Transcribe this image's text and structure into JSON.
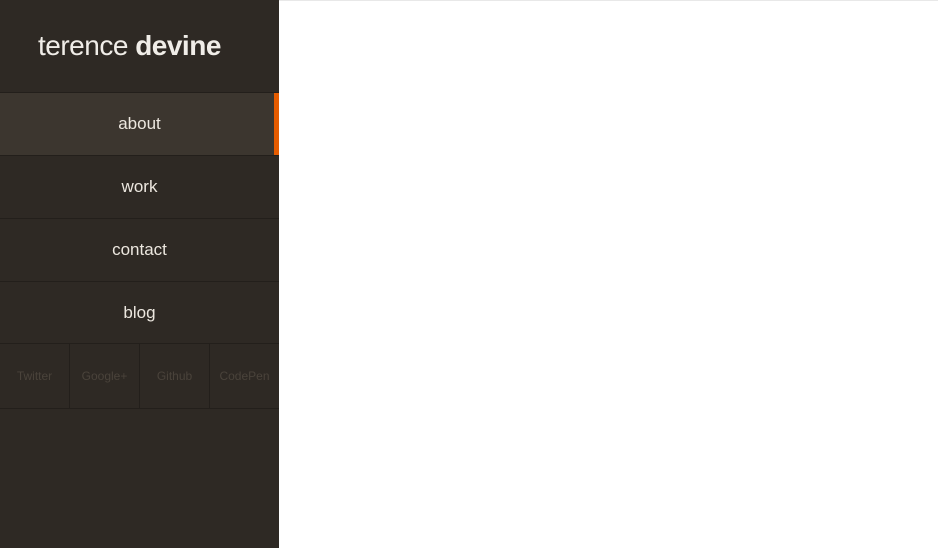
{
  "brand": {
    "first": "terence",
    "last": "devine"
  },
  "nav": {
    "items": [
      {
        "label": "about",
        "active": true
      },
      {
        "label": "work",
        "active": false
      },
      {
        "label": "contact",
        "active": false
      },
      {
        "label": "blog",
        "active": false
      }
    ]
  },
  "social": {
    "items": [
      {
        "label": "Twitter"
      },
      {
        "label": "Google+"
      },
      {
        "label": "Github"
      },
      {
        "label": "CodePen"
      }
    ]
  }
}
